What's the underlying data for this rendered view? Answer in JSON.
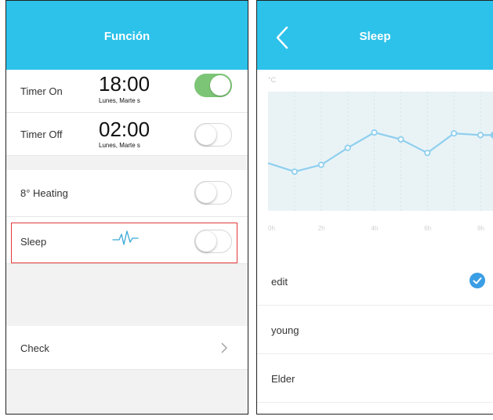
{
  "left_screen": {
    "title": "Función",
    "timer_on": {
      "label": "Timer On",
      "time": "18:00",
      "days": "Lunes, Marte s",
      "enabled": true
    },
    "timer_off": {
      "label": "Timer Off",
      "time": "02:00",
      "days": "Lunes, Marte s",
      "enabled": false
    },
    "heating": {
      "label": "8° Heating",
      "enabled": false
    },
    "sleep": {
      "label": "Sleep",
      "enabled": false
    },
    "check": {
      "label": "Check"
    }
  },
  "right_screen": {
    "title": "Sleep",
    "unit": "°C",
    "modes": [
      {
        "label": "edit",
        "selected": true
      },
      {
        "label": "young",
        "selected": false
      },
      {
        "label": "Elder",
        "selected": false
      }
    ]
  },
  "colors": {
    "header": "#2dc2ea",
    "toggle_on": "#7cc576",
    "chart_line": "#8fcfee",
    "chart_bg": "#e9f3f6",
    "check": "#3a9ee5",
    "highlight": "#e23a3a"
  },
  "chart_data": {
    "type": "line",
    "x_ticks": [
      "0h",
      "2h",
      "4h",
      "6h",
      "8h"
    ],
    "x": [
      0,
      1,
      2,
      3,
      4,
      5,
      6,
      7,
      8,
      8.5
    ],
    "values": [
      5.6,
      4.6,
      5.4,
      7.4,
      9.2,
      8.4,
      6.8,
      9.1,
      8.9,
      8.9
    ],
    "ylim": [
      0,
      14
    ],
    "xlabel": "",
    "ylabel": "°C",
    "grid": "vertical-dashed"
  }
}
